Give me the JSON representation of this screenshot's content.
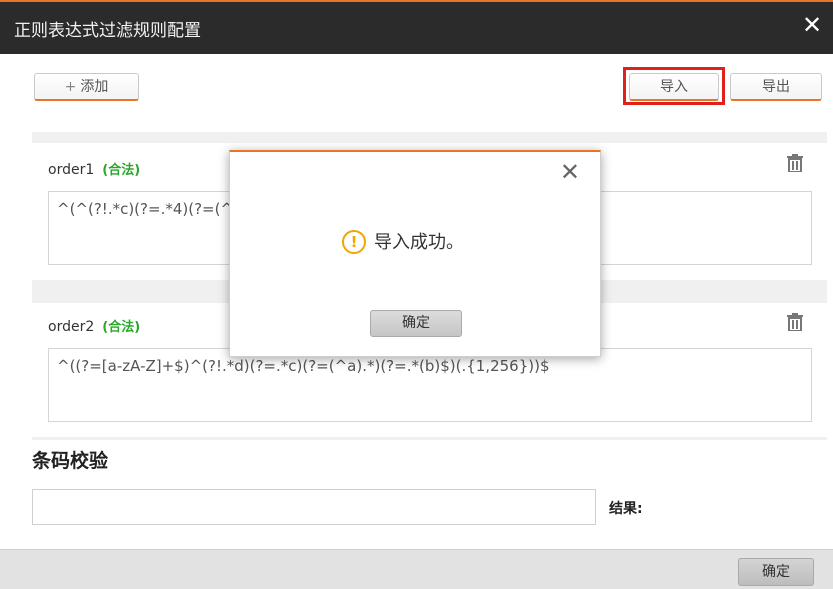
{
  "window": {
    "title": "正则表达式过滤规则配置"
  },
  "toolbar": {
    "add_label": "添加",
    "import_label": "导入",
    "export_label": "导出"
  },
  "rules": [
    {
      "name": "order1",
      "status": "(合法)",
      "regex": "^(^(?!.*c)(?=.*4)(?=(^"
    },
    {
      "name": "order2",
      "status": "(合法)",
      "regex": "^((?=[a-zA-Z]+$)^(?!.*d)(?=.*c)(?=(^a).*)(?=.*(b)$)(.{1,256}))$"
    }
  ],
  "barcode": {
    "title": "条码校验",
    "input_value": "",
    "result_label": "结果:"
  },
  "footer": {
    "ok_label": "确定"
  },
  "modal": {
    "message": "导入成功。",
    "ok_label": "确定"
  },
  "colors": {
    "accent": "#e8742a",
    "highlight": "#e0201b",
    "valid": "#2aa62a",
    "warning": "#f0a500"
  },
  "icons": {
    "close": "close-icon",
    "trash": "trash-icon",
    "warning": "warning-icon",
    "plus": "plus-icon"
  }
}
